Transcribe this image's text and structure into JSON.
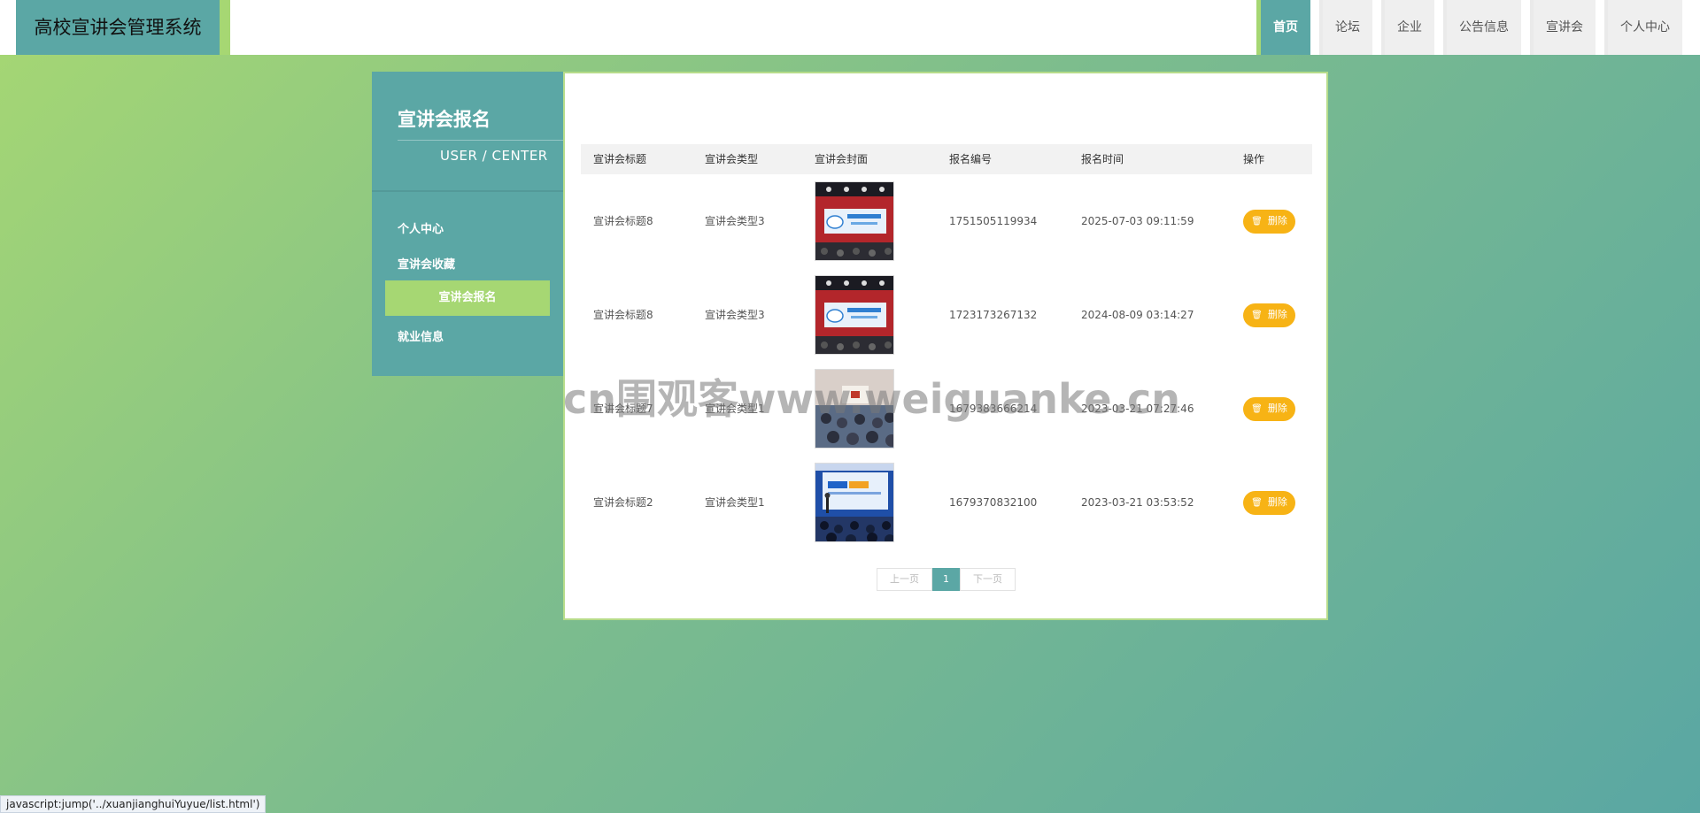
{
  "header": {
    "brand": "高校宣讲会管理系统",
    "nav": [
      {
        "label": "首页",
        "active": true
      },
      {
        "label": "论坛",
        "active": false
      },
      {
        "label": "企业",
        "active": false
      },
      {
        "label": "公告信息",
        "active": false
      },
      {
        "label": "宣讲会",
        "active": false
      },
      {
        "label": "个人中心",
        "active": false
      }
    ]
  },
  "sidebar": {
    "title": "宣讲会报名",
    "subtitle": "USER / CENTER",
    "items": [
      {
        "label": "个人中心",
        "active": false
      },
      {
        "label": "宣讲会收藏",
        "active": false
      },
      {
        "label": "宣讲会报名",
        "active": true
      },
      {
        "label": "就业信息",
        "active": false
      }
    ]
  },
  "table": {
    "headers": [
      "宣讲会标题",
      "宣讲会类型",
      "宣讲会封面",
      "报名编号",
      "报名时间",
      "操作"
    ],
    "rows": [
      {
        "title": "宣讲会标题8",
        "type": "宣讲会类型3",
        "cover": "hall-red-banner",
        "number": "1751505119934",
        "time": "2025-07-03 09:11:59",
        "action": "删除"
      },
      {
        "title": "宣讲会标题8",
        "type": "宣讲会类型3",
        "cover": "hall-red-banner",
        "number": "1723173267132",
        "time": "2024-08-09 03:14:27",
        "action": "删除"
      },
      {
        "title": "宣讲会标题7",
        "type": "宣讲会类型1",
        "cover": "audience-room",
        "number": "1679383666214",
        "time": "2023-03-21 07:27:46",
        "action": "删除"
      },
      {
        "title": "宣讲会标题2",
        "type": "宣讲会类型1",
        "cover": "blue-screen",
        "number": "1679370832100",
        "time": "2023-03-21 03:53:52",
        "action": "删除"
      }
    ]
  },
  "pagination": {
    "prev": "上一页",
    "current": "1",
    "next": "下一页"
  },
  "watermark": "cn围观客www.weiguanke.cn",
  "statusbar": "javascript:jump('../xuanjianghuiYuyue/list.html')",
  "colors": {
    "primary": "#5ba7a5",
    "accent": "#a6d773",
    "delete": "#f7b315"
  }
}
